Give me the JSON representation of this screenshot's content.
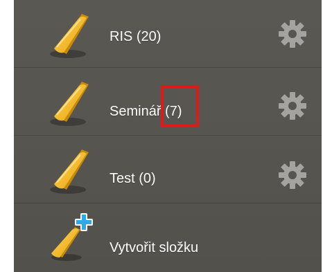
{
  "folders": [
    {
      "label": "RIS (20)"
    },
    {
      "label": "Seminář (7)"
    },
    {
      "label": "Test (0)"
    }
  ],
  "create_folder": {
    "label": "Vytvořit složku"
  },
  "colors": {
    "background": "#57554f",
    "folder": "#f3b81d",
    "gear": "#a5a39f",
    "plus": "#2ea9e3",
    "highlight": "#e0191b",
    "text": "#ffffff"
  },
  "icons": {
    "folder": "folder-icon",
    "settings": "gear-icon",
    "add": "plus-icon"
  }
}
